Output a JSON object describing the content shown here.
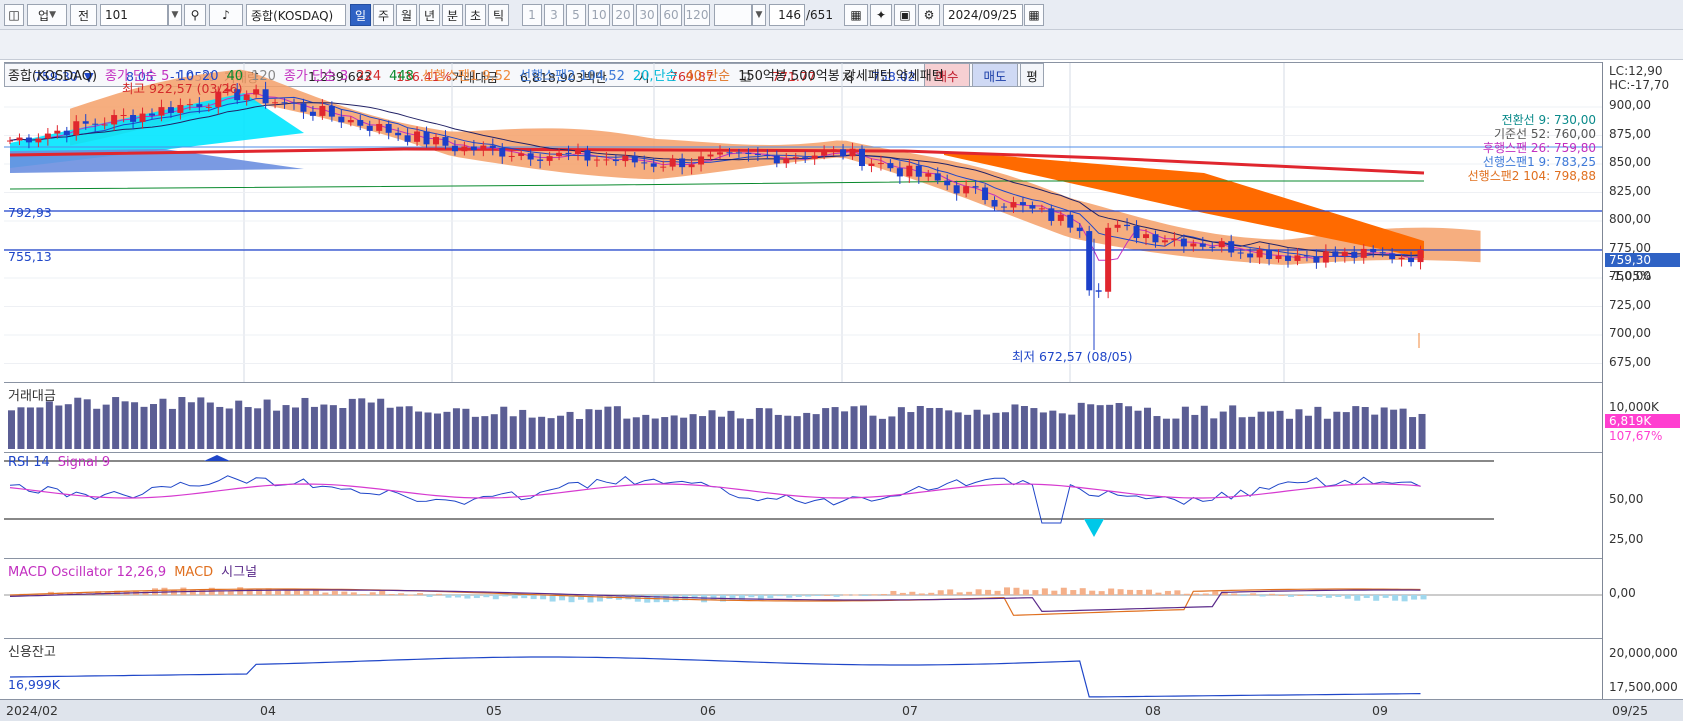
{
  "toolbar": {
    "market": "업",
    "period_select": "전",
    "code": "101",
    "name": "종합(KOSDAQ)",
    "periods": [
      "일",
      "주",
      "월",
      "년",
      "분",
      "초",
      "틱"
    ],
    "active_period": "일",
    "intervals": [
      "1",
      "3",
      "5",
      "10",
      "20",
      "30",
      "60",
      "120"
    ],
    "count": "146",
    "total": "/651",
    "date": "2024/09/25"
  },
  "quote": {
    "price": "759.30",
    "arrow": "▼",
    "change": "8.05",
    "change_pct": "-1.05%",
    "volume_label": "거래량",
    "volume": "1,239,693",
    "volume_pct": "136.41%",
    "amount_label": "거래대금",
    "amount": "6,818,903백만",
    "open_label": "시",
    "open": "769.87",
    "high_label": "고",
    "high": "771.77",
    "low_label": "저",
    "low": "758.02",
    "buy_label": "매수",
    "sell_label": "매도",
    "eval_label": "평"
  },
  "colors": {
    "up": "#e0262e",
    "down": "#1c40c9",
    "cloud_up": "#ff6a00",
    "cloud_down": "#6c8fe0",
    "cyan": "#00e5ff",
    "salmon": "#f4a069",
    "volume": "#5b5e94"
  },
  "price_panel": {
    "legend": [
      {
        "text": "종합(KOSDAQ)",
        "color": "#222222"
      },
      {
        "text": "종가 단순 5",
        "color": "#c22fc0"
      },
      {
        "text": "10",
        "color": "#1f46c8"
      },
      {
        "text": "20",
        "color": "#1f46c8"
      },
      {
        "text": "40",
        "color": "#0a8a2e"
      },
      {
        "text": "120",
        "color": "#888888"
      },
      {
        "text": "종가 단순 3",
        "color": "#c22fc0"
      },
      {
        "text": "224",
        "color": "#d42a2a"
      },
      {
        "text": "448",
        "color": "#0a8a2e"
      },
      {
        "text": "선행스팬1 9,52",
        "color": "#f08a3c"
      },
      {
        "text": "선행스팬2 104,52",
        "color": "#3c78d8"
      },
      {
        "text": "20,단순",
        "color": "#00b8d8"
      },
      {
        "text": "40,단순",
        "color": "#e07020"
      },
      {
        "text": "150억봉,500억봉 강세패턴  약세패턴",
        "color": "#222222"
      }
    ],
    "y_ticks": [
      "900,00",
      "875,00",
      "850,00",
      "825,00",
      "800,00",
      "775,00",
      "750,00",
      "725,00",
      "700,00",
      "675,00"
    ],
    "lc": "LC:12,90",
    "hc": "HC:-17,70",
    "current_price_tag": "759,30",
    "current_change_tag": "-1,05%",
    "line_792": "792,93",
    "line_755": "755,13",
    "high_note": "최고 922,57 (03/26)",
    "low_note": "최저 672,57 (08/05)",
    "right_labels": [
      "전환선 9: 730,00",
      "기준선 52: 760,00",
      "후행스팬 26: 759,80",
      "선행스팬1 9: 783,25",
      "선행스팬2 104: 798,88"
    ]
  },
  "amount_panel": {
    "title": "거래대금",
    "y_ticks": [
      "10,000K"
    ],
    "value_tag": "6,819K",
    "pct_tag": "107,67%"
  },
  "rsi_panel": {
    "title": "RSI 14",
    "signal": "Signal 9",
    "y_ticks": [
      "50,00",
      "25,00"
    ]
  },
  "macd_panel": {
    "title": "MACD Oscillator 12,26,9",
    "macd": "MACD",
    "signal": "시그널",
    "y_ticks": [
      "0,00"
    ]
  },
  "credit_panel": {
    "title": "신용잔고",
    "value": "16,999K",
    "y_ticks": [
      "20,000,000",
      "17,500,000"
    ]
  },
  "x_axis": {
    "labels": [
      {
        "text": "2024/02"
      },
      {
        "text": "04"
      },
      {
        "text": "05"
      },
      {
        "text": "06"
      },
      {
        "text": "07"
      },
      {
        "text": "08"
      },
      {
        "text": "09"
      }
    ],
    "end_label": "09/25"
  },
  "chart_data": {
    "type": "line",
    "x": [
      "2024/02",
      "04",
      "05",
      "06",
      "07",
      "08",
      "09",
      "09/25"
    ],
    "series": [
      {
        "values": [
          865,
          910,
          860,
          845,
          855,
          790,
          760,
          759.3
        ]
      }
    ],
    "ylim": [
      660,
      910
    ]
  }
}
